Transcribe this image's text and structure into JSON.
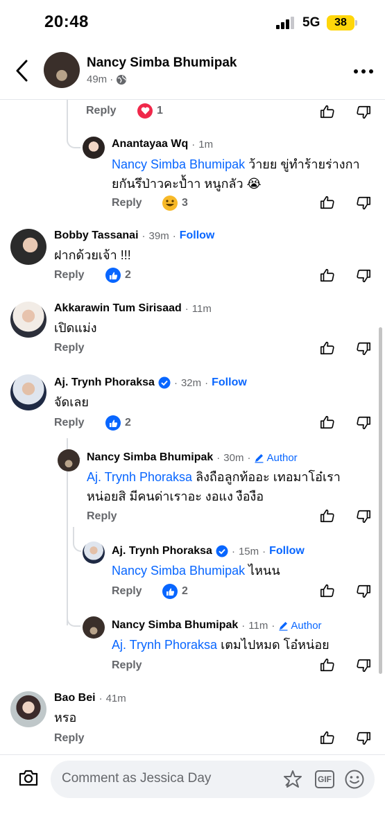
{
  "status": {
    "time": "20:48",
    "network": "5G",
    "battery": "38"
  },
  "header": {
    "name": "Nancy Simba Bhumipak",
    "time": "49m"
  },
  "top_reply": {
    "reply_label": "Reply",
    "reaction_count": "1"
  },
  "comments": {
    "anantayaa": {
      "name": "Anantayaa Wq",
      "time": "1m",
      "mention": "Nancy Simba Bhumipak",
      "text": " ว้ายย ขู่ทำร้ายร่างกายกันรึป่าวคะป้ำา หนูกลัว 😭",
      "reply_label": "Reply",
      "reaction_count": "3"
    },
    "bobby": {
      "name": "Bobby Tassanai",
      "time": "39m",
      "follow": "Follow",
      "text": "ฝากด้วยเจ้า !!!",
      "reply_label": "Reply",
      "reaction_count": "2"
    },
    "akkarawin": {
      "name": "Akkarawin Tum Sirisaad",
      "time": "11m",
      "text": "เปิดแม่ง",
      "reply_label": "Reply"
    },
    "trynh": {
      "name": "Aj. Trynh Phoraksa",
      "time": "32m",
      "follow": "Follow",
      "text": "จัดเลย",
      "reply_label": "Reply",
      "reaction_count": "2"
    },
    "nancy1": {
      "name": "Nancy Simba Bhumipak",
      "time": "30m",
      "author": "Author",
      "mention": "Aj. Trynh Phoraksa",
      "text_line1": " ลิงถือลูกท้ออะ เทอมาโอ๋เรา",
      "text_line2": "หน่อยสิ มีคนด่าเราอะ งอแง งืองือ",
      "reply_label": "Reply"
    },
    "trynh2": {
      "name": "Aj. Trynh Phoraksa",
      "time": "15m",
      "follow": "Follow",
      "mention": "Nancy Simba Bhumipak",
      "text": " ไหนน",
      "reply_label": "Reply",
      "reaction_count": "2"
    },
    "nancy2": {
      "name": "Nancy Simba Bhumipak",
      "time": "11m",
      "author": "Author",
      "mention": "Aj. Trynh Phoraksa",
      "text": " เตมไปหมด โอ๋หน่อย",
      "reply_label": "Reply"
    },
    "baobei": {
      "name": "Bao Bei",
      "time": "41m",
      "text": "หรอ",
      "reply_label": "Reply"
    }
  },
  "composer": {
    "placeholder": "Comment as Jessica Day",
    "gif_label": "GIF"
  },
  "colors": {
    "link": "#0866ff",
    "secondary": "#65676b",
    "love": "#f0284a",
    "battery": "#ffd60a"
  }
}
